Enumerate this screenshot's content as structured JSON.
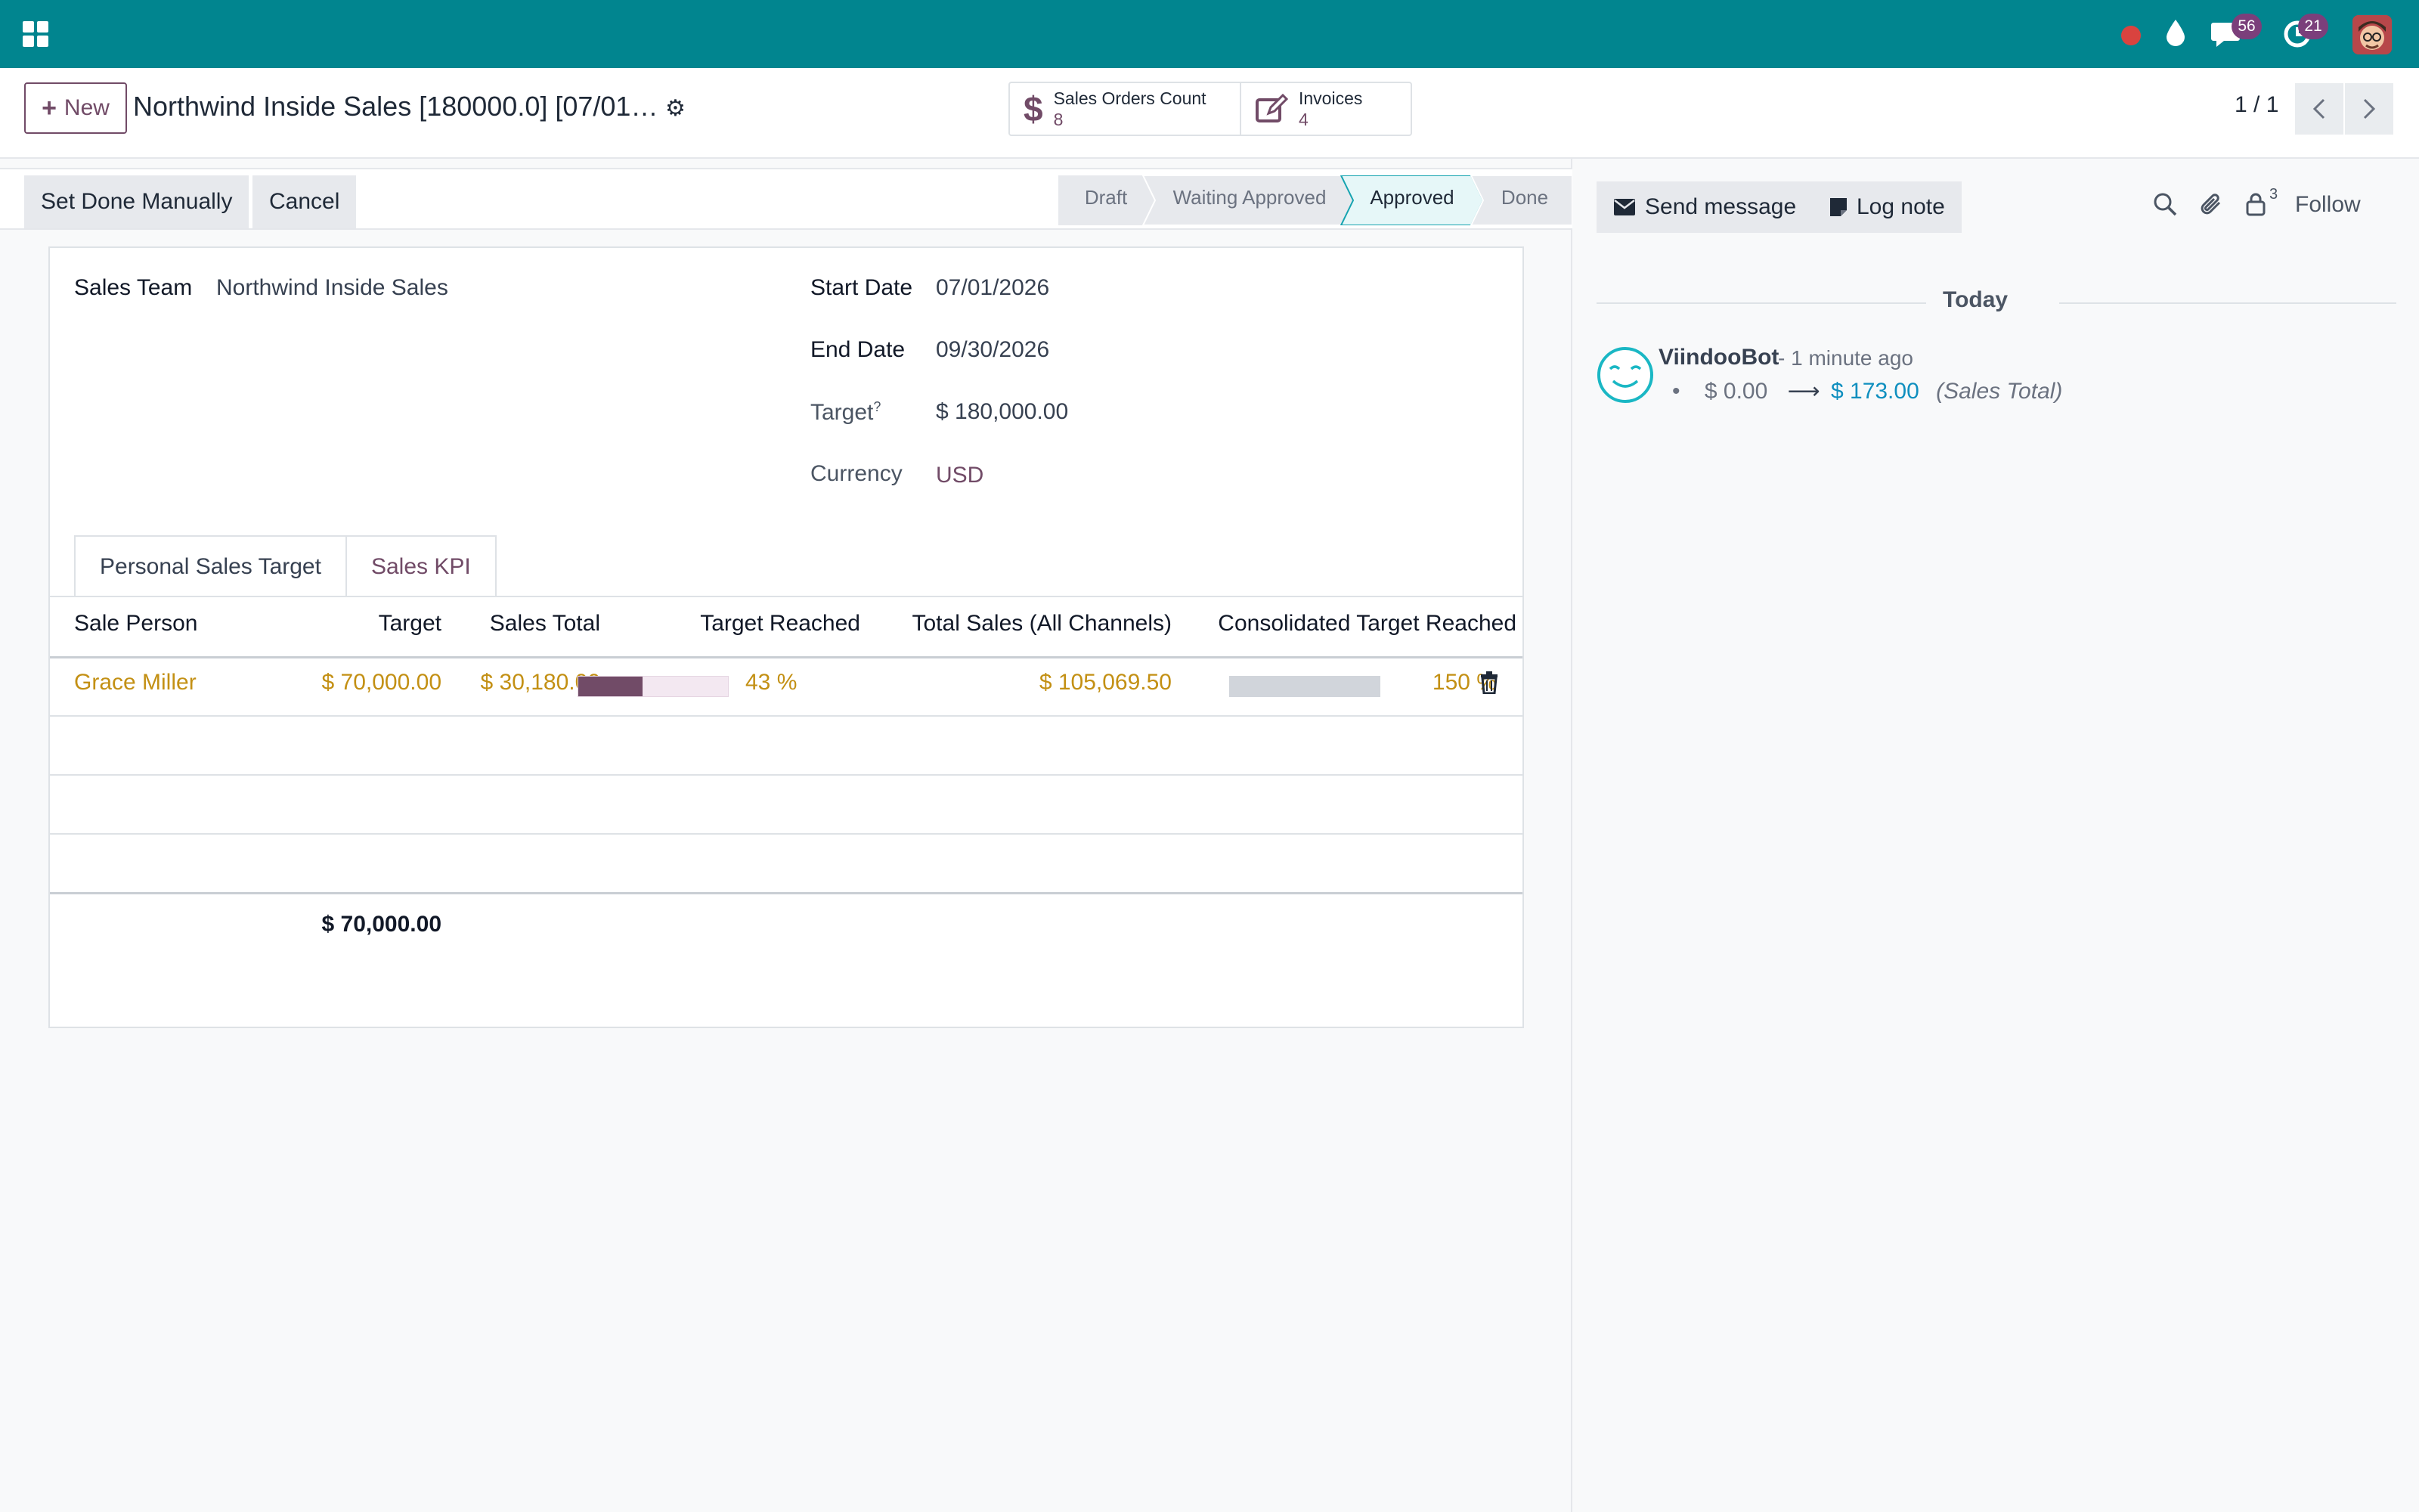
{
  "navbar": {
    "messages_badge": "56",
    "activities_badge": "21"
  },
  "control": {
    "new_label": "New",
    "record_title": "Northwind Inside Sales [180000.0] [07/01…",
    "smart_buttons": [
      {
        "label": "Sales Orders Count",
        "value": "8",
        "icon": "dollar-icon"
      },
      {
        "label": "Invoices",
        "value": "4",
        "icon": "edit-icon"
      }
    ],
    "pager": "1 / 1"
  },
  "statusbar": {
    "actions": [
      "Set Done Manually",
      "Cancel"
    ],
    "stages": [
      "Draft",
      "Waiting Approved",
      "Approved",
      "Done"
    ],
    "active_stage": "Approved"
  },
  "form": {
    "sales_team_label": "Sales Team",
    "sales_team_value": "Northwind Inside Sales",
    "start_date_label": "Start Date",
    "start_date_value": "07/01/2026",
    "end_date_label": "End Date",
    "end_date_value": "09/30/2026",
    "target_label": "Target",
    "target_help": "?",
    "target_value": "$ 180,000.00",
    "currency_label": "Currency",
    "currency_value": "USD"
  },
  "tabs": [
    "Personal Sales Target",
    "Sales KPI"
  ],
  "table": {
    "headers": [
      "Sale Person",
      "Target",
      "Sales Total",
      "Target Reached",
      "Total Sales (All Channels)",
      "Consolidated Target Reached"
    ],
    "rows": [
      {
        "sale_person": "Grace Miller",
        "target": "$ 70,000.00",
        "sales_total": "$ 30,180.00",
        "target_reached": "43 %",
        "target_reached_fraction": 0.43,
        "total_sales_all": "$ 105,069.50",
        "consolidated_reached": "150 %",
        "consolidated_reached_fraction": 1.0
      }
    ],
    "total_target": "$ 70,000.00"
  },
  "chatter": {
    "send_message": "Send message",
    "log_note": "Log note",
    "follower_count": "3",
    "follow": "Follow",
    "date_separator": "Today",
    "message": {
      "author": "ViindooBot",
      "time": "- 1 minute ago",
      "old_value": "$ 0.00",
      "new_value": "$ 173.00",
      "field": "(Sales Total)"
    }
  },
  "colors": {
    "navbar": "#01858f",
    "brand": "#714b67",
    "amount": "#c39014",
    "active_stage": "#15a3b0"
  }
}
